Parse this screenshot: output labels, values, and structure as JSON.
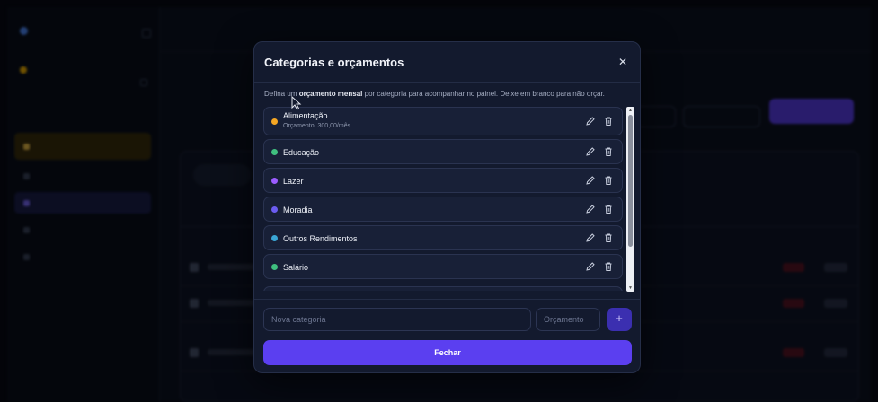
{
  "modal": {
    "title": "Categorias e orçamentos",
    "close_icon": "close-icon",
    "desc_prefix": "Defina um ",
    "desc_bold": "orçamento mensal",
    "desc_suffix": " por categoria para acompanhar no painel. Deixe em branco para não orçar.",
    "categories": [
      {
        "name": "Alimentação",
        "budget": "Orçamento: 300,00/mês",
        "color": "#f5a623"
      },
      {
        "name": "Educação",
        "budget": "",
        "color": "#3fbf7f"
      },
      {
        "name": "Lazer",
        "budget": "",
        "color": "#9b5cff"
      },
      {
        "name": "Moradia",
        "budget": "",
        "color": "#6b5cf0"
      },
      {
        "name": "Outros Rendimentos",
        "budget": "",
        "color": "#3aa6d6"
      },
      {
        "name": "Salário",
        "budget": "",
        "color": "#3fbf7f"
      }
    ],
    "new_category_placeholder": "Nova categoria",
    "budget_placeholder": "Orçamento",
    "add_label": "+",
    "close_button_label": "Fechar"
  },
  "colors": {
    "accent": "#5b3ff0",
    "modal_bg": "#131a2e",
    "item_bg": "#182037"
  },
  "icons": {
    "edit": "pencil-icon",
    "delete": "trash-icon"
  }
}
